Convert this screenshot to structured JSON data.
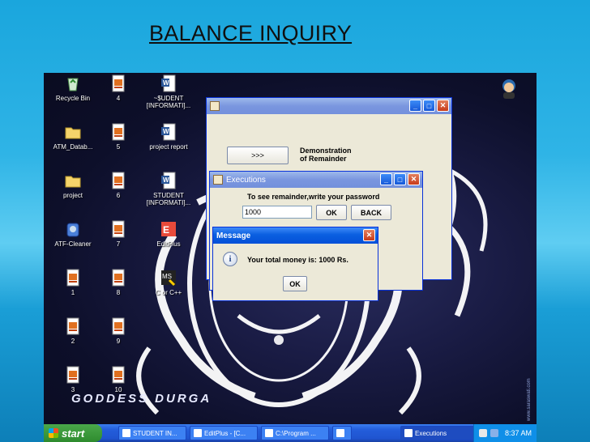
{
  "slide": {
    "title": "BALANCE INQUIRY"
  },
  "desktop_icons": [
    {
      "label": "Recycle Bin",
      "icon": "recycle-bin-icon"
    },
    {
      "label": "4",
      "icon": "java-file-icon"
    },
    {
      "label": "~$UDENT [INFORMATI]...",
      "icon": "word-doc-icon"
    },
    {
      "label": "ATM_Datab...",
      "icon": "folder-icon"
    },
    {
      "label": "5",
      "icon": "java-file-icon"
    },
    {
      "label": "project report",
      "icon": "word-doc-icon"
    },
    {
      "label": "project",
      "icon": "folder-icon"
    },
    {
      "label": "6",
      "icon": "java-file-icon"
    },
    {
      "label": "STUDENT [INFORMATI]...",
      "icon": "word-doc-icon"
    },
    {
      "label": "ATF-Cleaner",
      "icon": "cleaner-icon"
    },
    {
      "label": "7",
      "icon": "java-file-icon"
    },
    {
      "label": "EditPlus",
      "icon": "editplus-icon"
    },
    {
      "label": "1",
      "icon": "java-file-icon"
    },
    {
      "label": "8",
      "icon": "java-file-icon"
    },
    {
      "label": "C or C++",
      "icon": "compiler-icon"
    },
    {
      "label": "2",
      "icon": "java-file-icon"
    },
    {
      "label": "9",
      "icon": "java-file-icon"
    },
    {
      "label": "3",
      "icon": "java-file-icon"
    },
    {
      "label": "10",
      "icon": "java-file-icon"
    }
  ],
  "wallpaper": {
    "caption": "GODDESS DURGA",
    "side_credit": "www.saraswati.com"
  },
  "main_window": {
    "title": "",
    "button_label": ">>>",
    "description": "Demonstration\nof Remainder"
  },
  "executions_window": {
    "title": "Executions",
    "prompt": "To see remainder,write your password",
    "password_value": "1000",
    "ok_label": "OK",
    "back_label": "BACK"
  },
  "message_dialog": {
    "title": "Message",
    "text": "Your total money is: 1000 Rs.",
    "ok_label": "OK",
    "icon": "info-icon"
  },
  "taskbar": {
    "start_label": "start",
    "items": [
      {
        "label": "STUDENT IN...",
        "icon": "word-doc-icon"
      },
      {
        "label": "EditPlus - [C...",
        "icon": "editplus-icon"
      },
      {
        "label": "C:\\Program ...",
        "icon": "console-icon"
      },
      {
        "label": "",
        "icon": "java-window-icon"
      },
      {
        "label": "Executions",
        "icon": "java-window-icon"
      }
    ],
    "clock": "8:37 AM"
  },
  "colors": {
    "xp_title_blue": "#0a5fe0",
    "desktop_bg": "#1a1c45",
    "slide_bg": "#2fb4e6"
  }
}
